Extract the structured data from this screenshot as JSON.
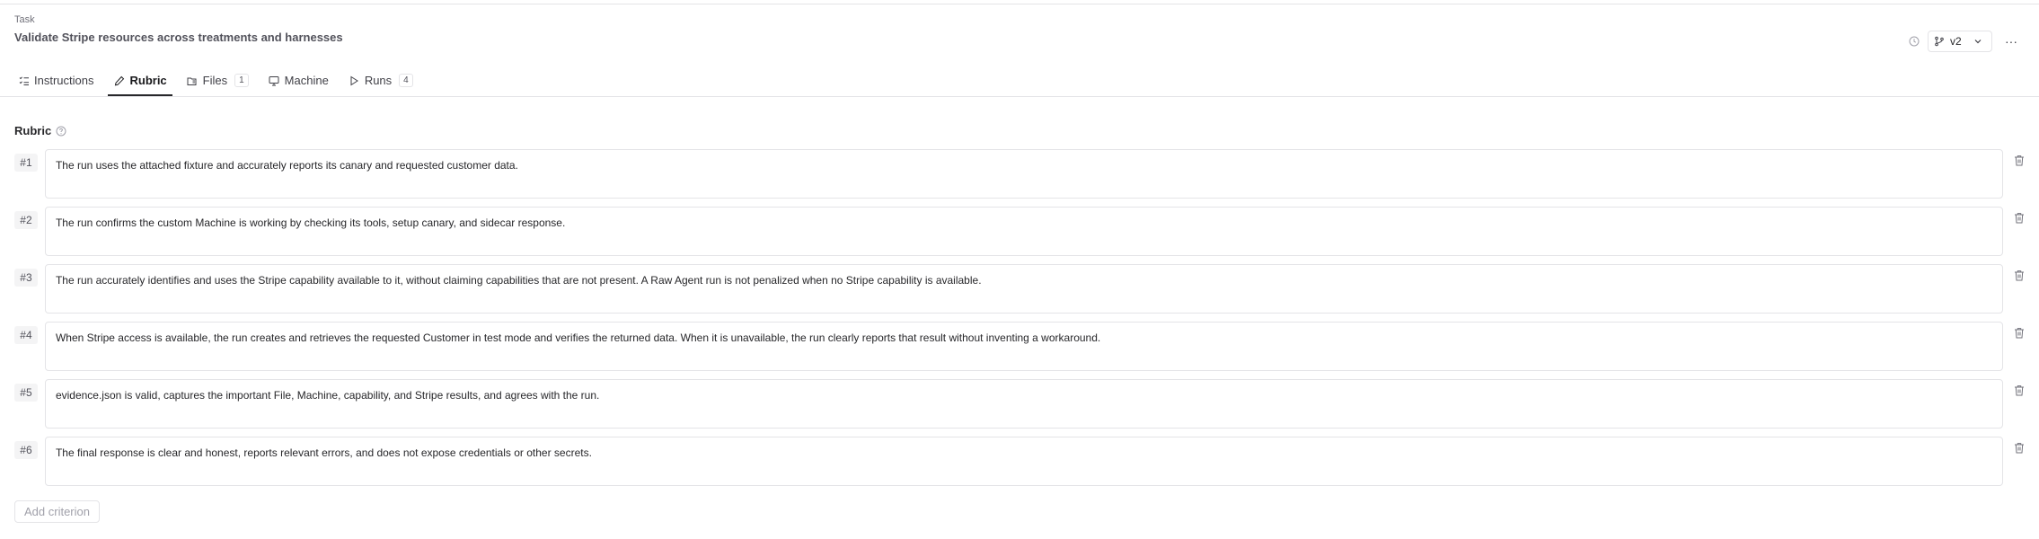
{
  "header": {
    "eyebrow": "Task",
    "title": "Validate Stripe resources across treatments and harnesses",
    "version_label": "v2",
    "more_label": "···"
  },
  "tabs": [
    {
      "label": "Instructions",
      "icon": "list-checks-icon",
      "active": false
    },
    {
      "label": "Rubric",
      "icon": "pencil-icon",
      "active": true
    },
    {
      "label": "Files",
      "icon": "files-icon",
      "count": "1",
      "active": false
    },
    {
      "label": "Machine",
      "icon": "monitor-icon",
      "active": false
    },
    {
      "label": "Runs",
      "icon": "play-icon",
      "count": "4",
      "active": false
    }
  ],
  "rubric": {
    "label": "Rubric",
    "add_label": "Add criterion",
    "criteria": [
      {
        "num": "#1",
        "text": "The run uses the attached fixture and accurately reports its canary and requested customer data."
      },
      {
        "num": "#2",
        "text": "The run confirms the custom Machine is working by checking its tools, setup canary, and sidecar response."
      },
      {
        "num": "#3",
        "text": "The run accurately identifies and uses the Stripe capability available to it, without claiming capabilities that are not present. A Raw Agent run is not penalized when no Stripe capability is available."
      },
      {
        "num": "#4",
        "text": "When Stripe access is available, the run creates and retrieves the requested Customer in test mode and verifies the returned data. When it is unavailable, the run clearly reports that result without inventing a workaround."
      },
      {
        "num": "#5",
        "text": "evidence.json is valid, captures the important File, Machine, capability, and Stripe results, and agrees with the run."
      },
      {
        "num": "#6",
        "text": "The final response is clear and honest, reports relevant errors, and does not expose credentials or other secrets."
      }
    ]
  }
}
